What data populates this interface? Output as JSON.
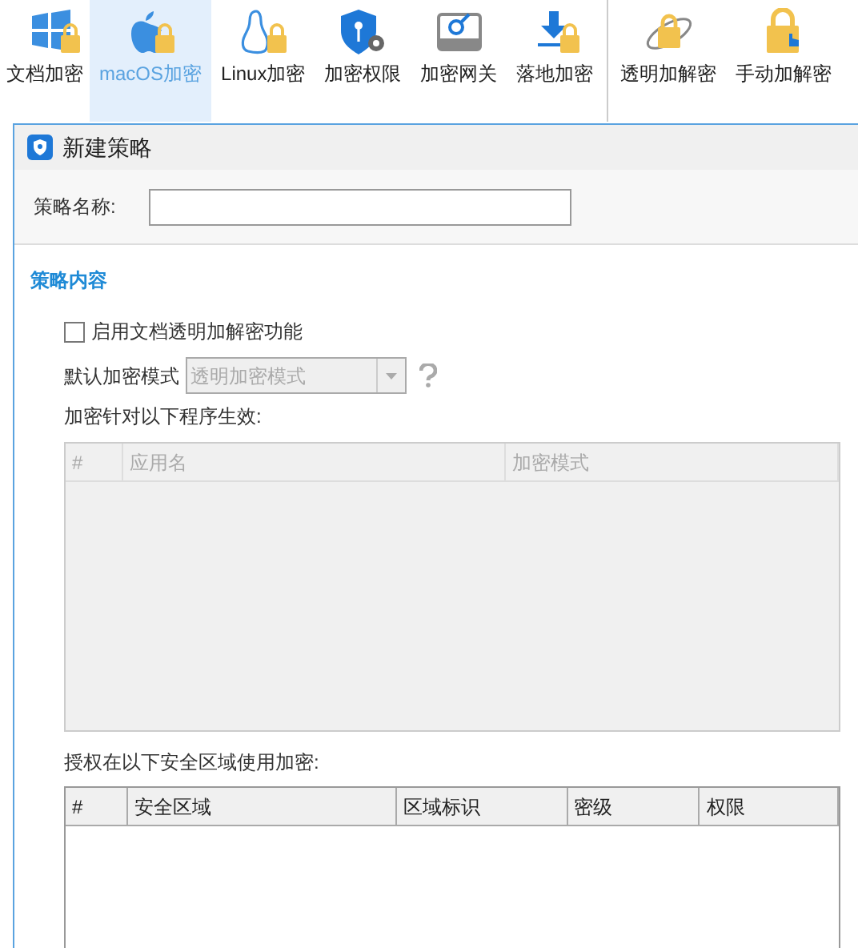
{
  "toolbar": [
    {
      "label": "文档加密",
      "selected": false
    },
    {
      "label": "macOS加密",
      "selected": true
    },
    {
      "label": "Linux加密",
      "selected": false
    },
    {
      "label": "加密权限",
      "selected": false
    },
    {
      "label": "加密网关",
      "selected": false
    },
    {
      "label": "落地加密",
      "selected": false
    },
    {
      "label": "透明加解密",
      "selected": false
    },
    {
      "label": "手动加解密",
      "selected": false
    }
  ],
  "dialog": {
    "title": "新建策略",
    "name_field": {
      "label": "策略名称:"
    },
    "section": "策略内容",
    "enable_checkbox": {
      "label": "启用文档透明加解密功能",
      "checked": false
    },
    "mode_select": {
      "label": "默认加密模式",
      "value": "透明加密模式",
      "disabled": true
    },
    "apps_label": "加密针对以下程序生效:",
    "apps_table": {
      "disabled": true,
      "columns": [
        "#",
        "应用名",
        "加密模式"
      ]
    },
    "zones_label": "授权在以下安全区域使用加密:",
    "zones_table": {
      "disabled": false,
      "columns": [
        "#",
        "安全区域",
        "区域标识",
        "密级",
        "权限"
      ]
    }
  }
}
